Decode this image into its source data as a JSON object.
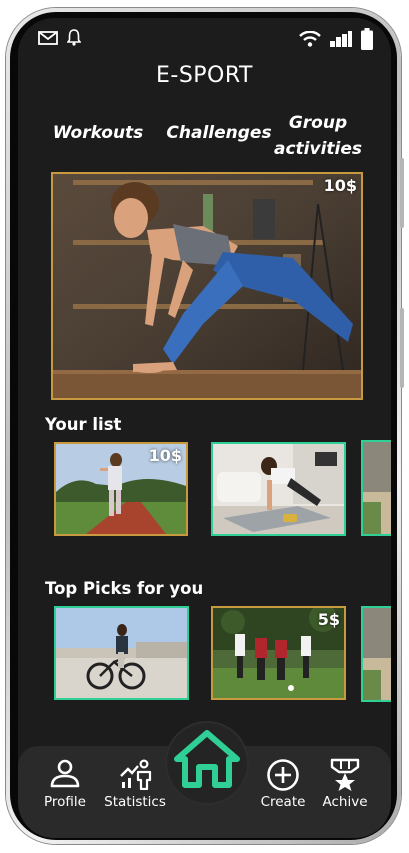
{
  "app": {
    "title": "E-SPORT"
  },
  "status_bar": {
    "left_icons": [
      "mail-icon",
      "bell-icon"
    ],
    "right_icons": [
      "wifi-icon",
      "signal-icon",
      "battery-icon"
    ]
  },
  "tabs": [
    {
      "label": "Workouts"
    },
    {
      "label": "Challenges"
    },
    {
      "label": "Group activities"
    }
  ],
  "featured": {
    "price": "10$",
    "image": "woman-stretching-lunge-photo"
  },
  "your_list": {
    "title": "Your list",
    "items": [
      {
        "price": "10$",
        "image": "woman-running-track-photo"
      },
      {
        "price": "",
        "image": "woman-plank-on-mat-photo"
      },
      {
        "price": "",
        "image": "outdoor-path-photo"
      }
    ]
  },
  "top_picks": {
    "title": "Top Picks for you",
    "items": [
      {
        "price": "",
        "image": "man-cycling-photo"
      },
      {
        "price": "5$",
        "image": "football-match-photo"
      },
      {
        "price": "",
        "image": "outdoor-path-photo"
      }
    ]
  },
  "nav": {
    "items": [
      {
        "label": "Profile",
        "icon": "profile-icon"
      },
      {
        "label": "Statistics",
        "icon": "statistics-icon"
      },
      {
        "label": "",
        "icon": "home-icon"
      },
      {
        "label": "Create",
        "icon": "plus-circle-icon"
      },
      {
        "label": "Achive",
        "icon": "medal-icon"
      }
    ]
  },
  "colors": {
    "screen_bg": "#1c1c1c",
    "accent_green": "#2fcf96",
    "accent_gold": "#c79a3f",
    "nav_bg": "#2a2a2a"
  }
}
